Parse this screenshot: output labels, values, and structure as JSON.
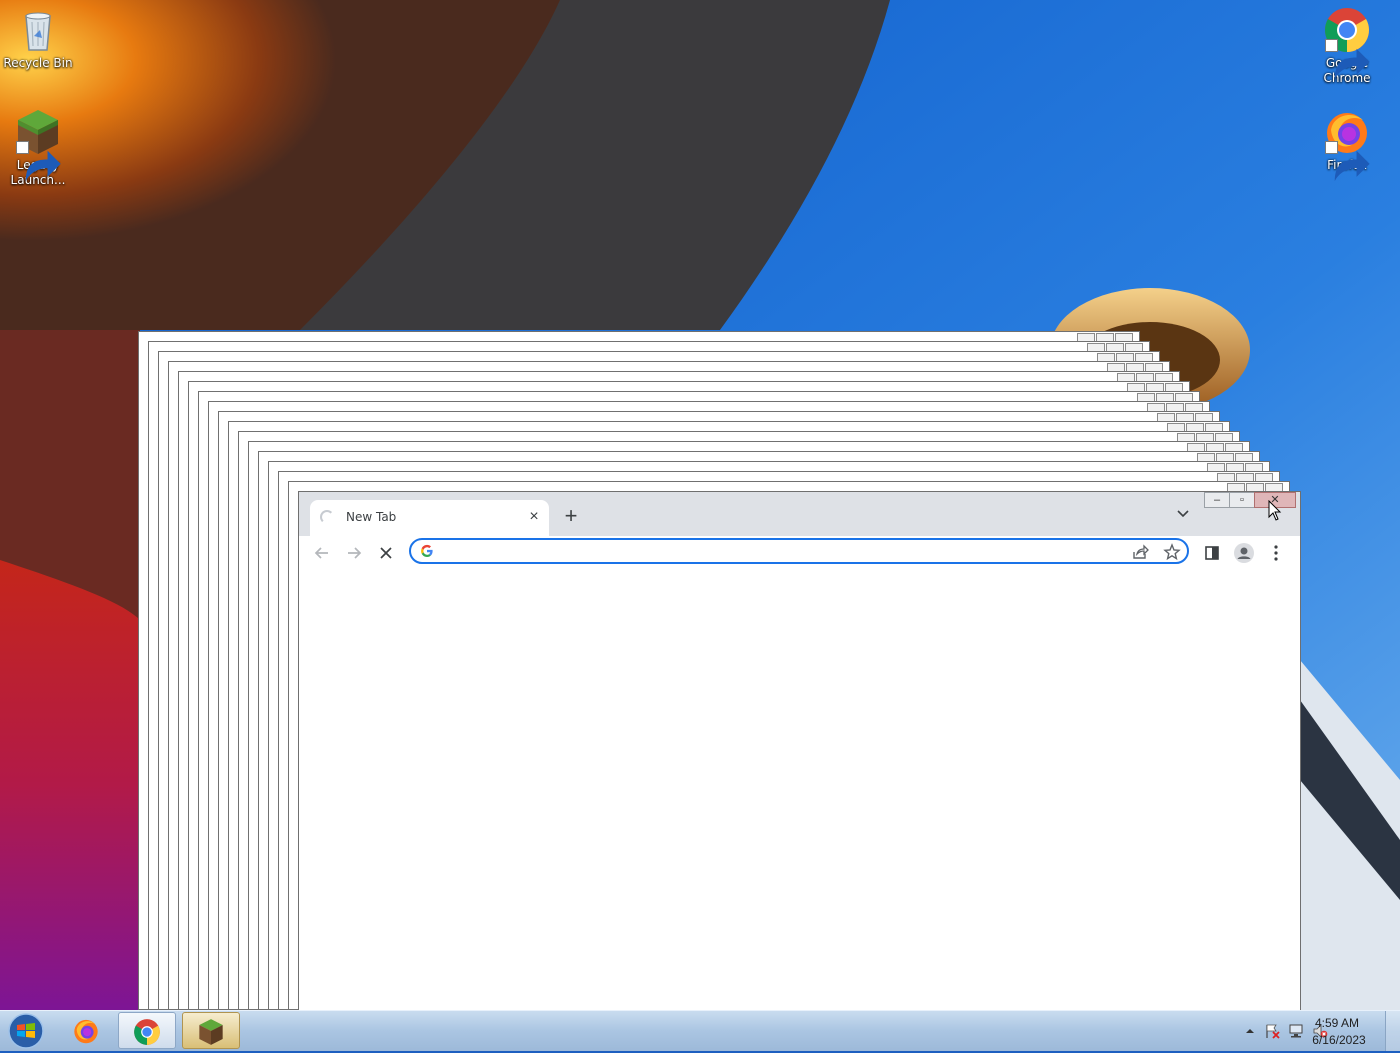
{
  "desktop": {
    "icons_left": [
      {
        "label": "Recycle Bin",
        "icon": "recycle-bin-icon"
      },
      {
        "label": "Legacy\nLaunch...",
        "icon": "minecraft-grass-block-icon"
      }
    ],
    "icons_right": [
      {
        "label": "Google\nChrome",
        "icon": "chrome-icon"
      },
      {
        "label": "Firefox",
        "icon": "firefox-icon"
      }
    ]
  },
  "browser": {
    "tab": {
      "title": "New Tab",
      "loading": true
    },
    "omnibox": {
      "value": "",
      "placeholder": ""
    },
    "colors": {
      "accent": "#1a73e8",
      "tabstrip": "#dee1e6",
      "close_hover": "#dfb6b8"
    }
  },
  "taskbar": {
    "apps": [
      {
        "name": "firefox",
        "icon": "firefox-icon"
      },
      {
        "name": "chrome",
        "icon": "chrome-icon",
        "state": "active"
      },
      {
        "name": "legacy-launcher",
        "icon": "minecraft-grass-block-icon",
        "state": "open"
      }
    ],
    "tray_icons": [
      "show-hidden-icons-chevron-icon",
      "action-center-flag-icon",
      "network-icon",
      "volume-muted-icon"
    ],
    "clock": {
      "time": "4:59 AM",
      "date": "6/16/2023"
    }
  }
}
